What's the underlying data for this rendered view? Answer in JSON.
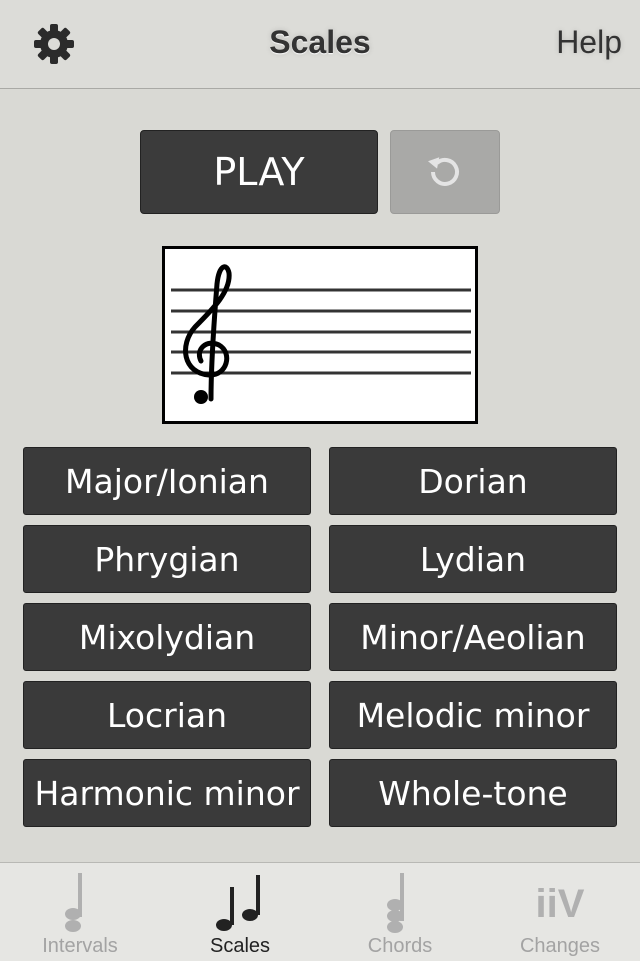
{
  "header": {
    "title": "Scales",
    "help_label": "Help",
    "settings_icon": "gear-icon"
  },
  "controls": {
    "play_label": "PLAY",
    "replay_icon": "replay-icon"
  },
  "staff": {
    "clef": "treble-clef"
  },
  "scales": [
    "Major/Ionian",
    "Dorian",
    "Phrygian",
    "Lydian",
    "Mixolydian",
    "Minor/Aeolian",
    "Locrian",
    "Melodic minor",
    "Harmonic minor",
    "Whole-tone"
  ],
  "tabs": [
    {
      "label": "Intervals",
      "icon": "interval-note-icon",
      "active": false
    },
    {
      "label": "Scales",
      "icon": "scale-notes-icon",
      "active": true
    },
    {
      "label": "Chords",
      "icon": "chord-notes-icon",
      "active": false
    },
    {
      "label": "Changes",
      "icon": "iiv-icon",
      "active": false
    }
  ],
  "tab_glyph_text": "iiV",
  "colors": {
    "background": "#d9d9d4",
    "button": "#3a3a3a",
    "active_tab": "#222222",
    "inactive_tab": "#a3a3a3"
  }
}
